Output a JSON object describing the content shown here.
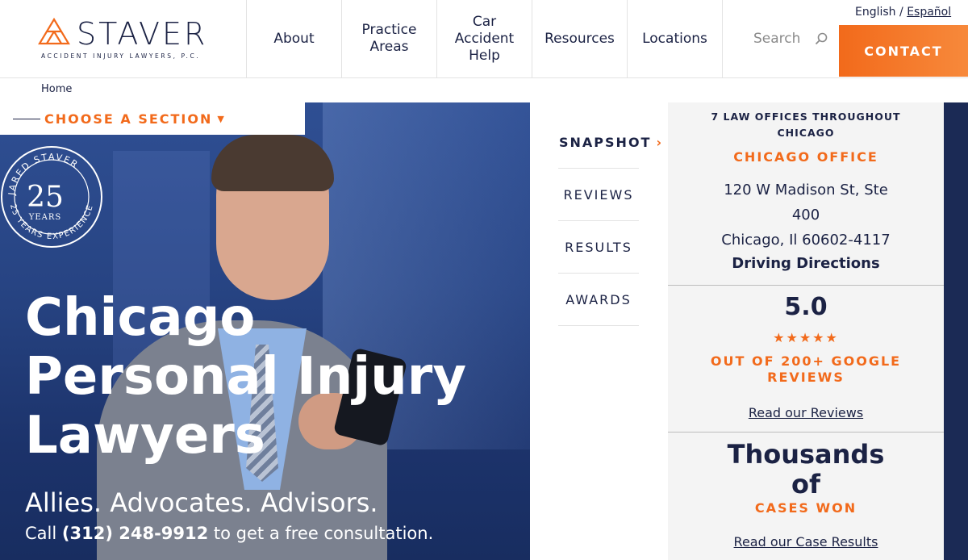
{
  "header": {
    "logo_word": "STAVER",
    "logo_tagline": "ACCIDENT INJURY LAWYERS, P.C.",
    "nav": [
      {
        "label": "About"
      },
      {
        "label": "Practice\nAreas"
      },
      {
        "label": "Car\nAccident\nHelp"
      },
      {
        "label": "Resources"
      },
      {
        "label": "Locations"
      }
    ],
    "search_placeholder": "Search",
    "lang_current": "English",
    "lang_sep": " / ",
    "lang_alt": "Español",
    "contact_label": "CONTACT"
  },
  "breadcrumb": {
    "home": "Home"
  },
  "hero": {
    "section_chooser": "CHOOSE A SECTION",
    "seal_top": "JARED STAVER",
    "seal_number": "25",
    "seal_years": "YEARS",
    "seal_bottom": "25 YEARS EXPERIENCE",
    "title": "Chicago Personal Injury Lawyers",
    "tagline": "Allies. Advocates. Advisors.",
    "call_prefix": "Call ",
    "phone": "(312) 248-9912",
    "call_suffix": " to get a free consultation."
  },
  "snapshot_nav": [
    {
      "label": "SNAPSHOT"
    },
    {
      "label": "REVIEWS"
    },
    {
      "label": "RESULTS"
    },
    {
      "label": "AWARDS"
    }
  ],
  "info": {
    "offices": "7 LAW OFFICES THROUGHOUT\nCHICAGO",
    "office_name": "CHICAGO OFFICE",
    "address": "120 W Madison St, Ste\n400\nChicago, Il 60602-4117",
    "directions": "Driving Directions",
    "rating": "5.0",
    "stars": "★★★★★",
    "reviews_label": "OUT OF 200+ GOOGLE\nREVIEWS",
    "reviews_link": "Read our Reviews",
    "thousands": "Thousands\nof",
    "cases_label": "CASES WON",
    "results_link": "Read our Case Results"
  },
  "colors": {
    "accent": "#f26a1b",
    "navy": "#1b2244"
  }
}
